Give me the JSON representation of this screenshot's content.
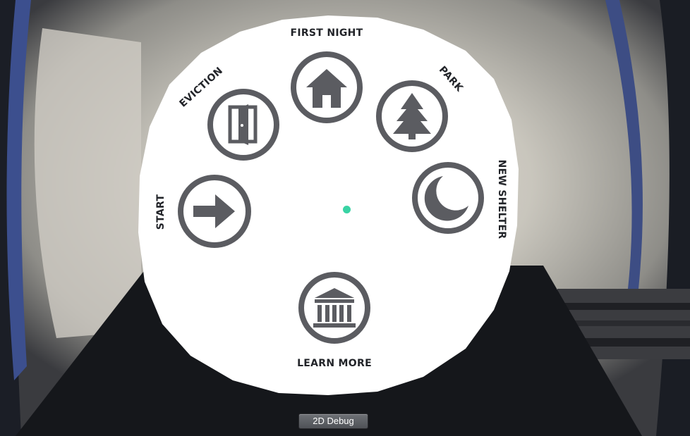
{
  "menu": {
    "items": [
      {
        "id": "start",
        "label": "START",
        "icon": "arrow-right-icon"
      },
      {
        "id": "eviction",
        "label": "EVICTION",
        "icon": "door-icon"
      },
      {
        "id": "first-night",
        "label": "FIRST NIGHT",
        "icon": "house-icon"
      },
      {
        "id": "park",
        "label": "PARK",
        "icon": "pine-tree-icon"
      },
      {
        "id": "new-shelter",
        "label": "NEW SHELTER",
        "icon": "crescent-moon-icon"
      },
      {
        "id": "learn-more",
        "label": "LEARN MORE",
        "icon": "museum-icon"
      }
    ]
  },
  "debug": {
    "label": "2D Debug"
  },
  "colors": {
    "icon": "#5b5c61",
    "label": "#222429",
    "disc": "#ffffff",
    "cursor": "#39d3a4"
  }
}
